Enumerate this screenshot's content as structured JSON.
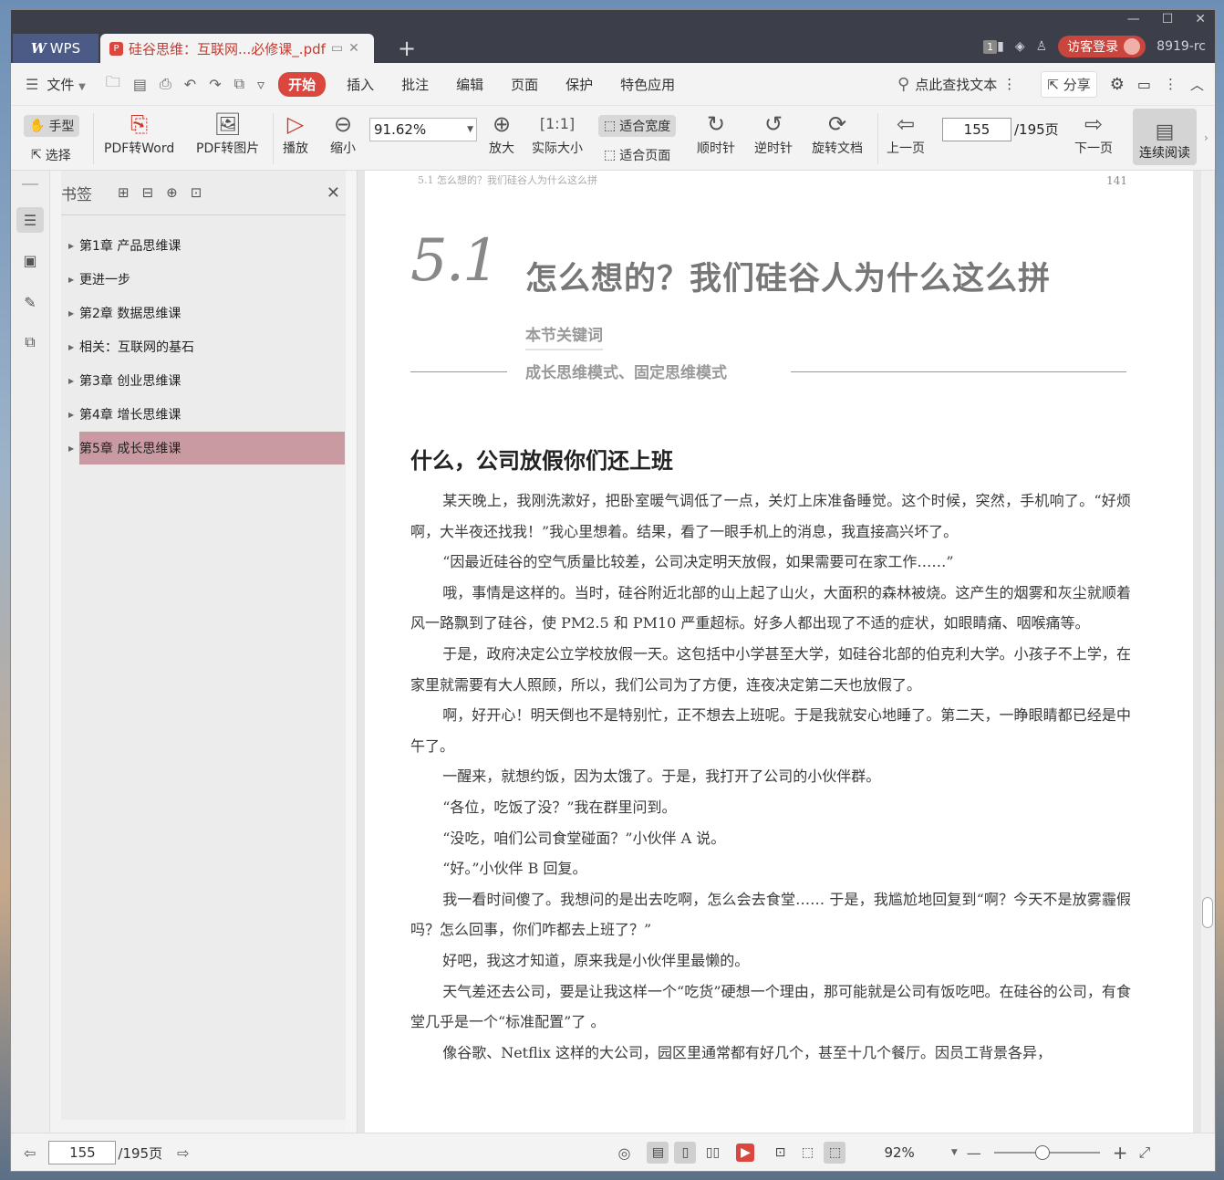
{
  "titlebar": {
    "app_name": "WPS",
    "doc_tab_title": "硅谷思维：互联网...必修课_.pdf",
    "new_tab_symbol": "+",
    "tab_count": "1",
    "login_label": "访客登录",
    "user_id": "8919-rc"
  },
  "menubar": {
    "file_label": "文件",
    "items": [
      "开始",
      "插入",
      "批注",
      "编辑",
      "页面",
      "保护",
      "特色应用"
    ],
    "search_label": "点此查找文本",
    "share_label": "分享"
  },
  "toolbar": {
    "hand_label": "手型",
    "select_label": "选择",
    "pdf_to_word": "PDF转Word",
    "pdf_to_image": "PDF转图片",
    "play": "播放",
    "zoom_out": "缩小",
    "zoom_value": "91.62%",
    "zoom_in": "放大",
    "actual_size": "实际大小",
    "fit_width": "适合宽度",
    "fit_page": "适合页面",
    "rotate_cw": "顺时针",
    "rotate_ccw": "逆时针",
    "rotate_doc": "旋转文档",
    "prev_page": "上一页",
    "page_current": "155",
    "page_total": "/195页",
    "next_page": "下一页",
    "continuous": "连续阅读"
  },
  "bookmarks": {
    "title": "书签",
    "items": [
      {
        "label": "第1章 产品思维课",
        "selected": false
      },
      {
        "label": "更进一步",
        "selected": false
      },
      {
        "label": "第2章 数据思维课",
        "selected": false
      },
      {
        "label": "相关：互联网的基石",
        "selected": false
      },
      {
        "label": "第3章 创业思维课",
        "selected": false
      },
      {
        "label": "第4章 增长思维课",
        "selected": false
      },
      {
        "label": "第5章 成长思维课",
        "selected": true
      }
    ],
    "selected_color": "#c99aa1"
  },
  "document": {
    "running_head": "5.1 怎么想的？我们硅谷人为什么这么拼",
    "page_number": "141",
    "section_number": "5.1",
    "section_title": "怎么想的？我们硅谷人为什么这么拼",
    "keywords_label": "本节关键词",
    "keywords": "成长思维模式、固定思维模式",
    "heading": "什么，公司放假你们还上班",
    "paragraphs": [
      "某天晚上，我刚洗漱好，把卧室暖气调低了一点，关灯上床准备睡觉。这个时候，突然，手机响了。“好烦啊，大半夜还找我！”我心里想着。结果，看了一眼手机上的消息，我直接高兴坏了。",
      "“因最近硅谷的空气质量比较差，公司决定明天放假，如果需要可在家工作……”",
      "哦，事情是这样的。当时，硅谷附近北部的山上起了山火，大面积的森林被烧。这产生的烟雾和灰尘就顺着风一路飘到了硅谷，使 PM2.5 和 PM10 严重超标。好多人都出现了不适的症状，如眼睛痛、咽喉痛等。",
      "于是，政府决定公立学校放假一天。这包括中小学甚至大学，如硅谷北部的伯克利大学。小孩子不上学，在家里就需要有大人照顾，所以，我们公司为了方便，连夜决定第二天也放假了。",
      "啊，好开心！明天倒也不是特别忙，正不想去上班呢。于是我就安心地睡了。第二天，一睁眼睛都已经是中午了。",
      "一醒来，就想约饭，因为太饿了。于是，我打开了公司的小伙伴群。",
      "“各位，吃饭了没？”我在群里问到。",
      "“没吃，咱们公司食堂碰面？”小伙伴 A 说。",
      "“好。”小伙伴 B 回复。",
      "我一看时间傻了。我想问的是出去吃啊，怎么会去食堂…… 于是，我尴尬地回复到“啊？今天不是放雾霾假吗？怎么回事，你们咋都去上班了？”",
      "好吧，我这才知道，原来我是小伙伴里最懒的。",
      "天气差还去公司，要是让我这样一个“吃货”硬想一个理由，那可能就是公司有饭吃吧。在硅谷的公司，有食堂几乎是一个“标准配置”了 。",
      "像谷歌、Netflix 这样的大公司，园区里通常都有好几个，甚至十几个餐厅。因员工背景各异，"
    ]
  },
  "statusbar": {
    "page_current": "155",
    "page_total": "/195页",
    "zoom": "92%"
  },
  "colors": {
    "accent": "#d9473f",
    "titlebar_bg": "#3c3f4a",
    "wps_tab_bg": "#4c5a86"
  }
}
